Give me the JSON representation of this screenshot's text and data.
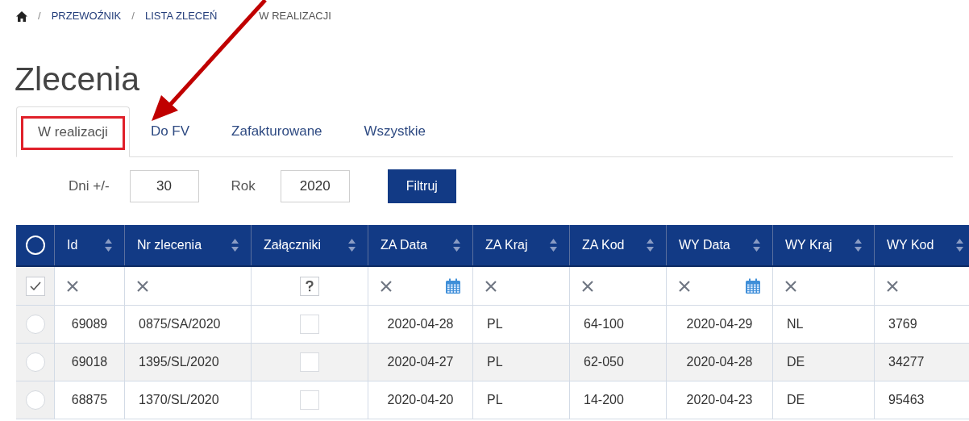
{
  "breadcrumb": [
    {
      "separator": "/",
      "label": "PRZEWOŹNIK"
    },
    {
      "separator": "/",
      "label": "LISTA ZLECEŃ"
    },
    {
      "label": "W REALIZACJI"
    }
  ],
  "title": "Zlecenia",
  "tabs": [
    {
      "label": "W realizacji",
      "selected": true
    },
    {
      "label": "Do FV",
      "selected": false
    },
    {
      "label": "Zafakturowane",
      "selected": false
    },
    {
      "label": "Wszystkie",
      "selected": false
    }
  ],
  "filters": {
    "days_label": "Dni +/-",
    "days_value": "30",
    "year_label": "Rok",
    "year_value": "2020",
    "button": "Filtruj"
  },
  "annotations": {
    "arrow": true,
    "tab_highlight": true
  },
  "table": {
    "select_all": {
      "selected": false
    },
    "columns": [
      {
        "label": "Id",
        "kind": "number"
      },
      {
        "label": "Nr zlecenia",
        "kind": "text"
      },
      {
        "label": "Załączniki",
        "kind": "attachment"
      },
      {
        "label": "ZA Data",
        "kind": "date"
      },
      {
        "label": "ZA Kraj",
        "kind": "text"
      },
      {
        "label": "ZA Kod",
        "kind": "text"
      },
      {
        "label": "WY Data",
        "kind": "date"
      },
      {
        "label": "WY Kraj",
        "kind": "text"
      },
      {
        "label": "WY Kod",
        "kind": "text"
      }
    ],
    "filter_checked": true,
    "attachment_filter_indeterminate": true,
    "rows": [
      {
        "selected": false,
        "attachment_checked": false,
        "cells": [
          "69089",
          "0875/SA/2020",
          null,
          "2020-04-28",
          "PL",
          "64-100",
          "2020-04-29",
          "NL",
          "3769"
        ]
      },
      {
        "selected": false,
        "attachment_checked": false,
        "cells": [
          "69018",
          "1395/SL/2020",
          null,
          "2020-04-27",
          "PL",
          "62-050",
          "2020-04-28",
          "DE",
          "34277"
        ]
      },
      {
        "selected": false,
        "attachment_checked": false,
        "cells": [
          "68875",
          "1370/SL/2020",
          null,
          "2020-04-20",
          "PL",
          "14-200",
          "2020-04-23",
          "DE",
          "95463"
        ]
      }
    ]
  }
}
